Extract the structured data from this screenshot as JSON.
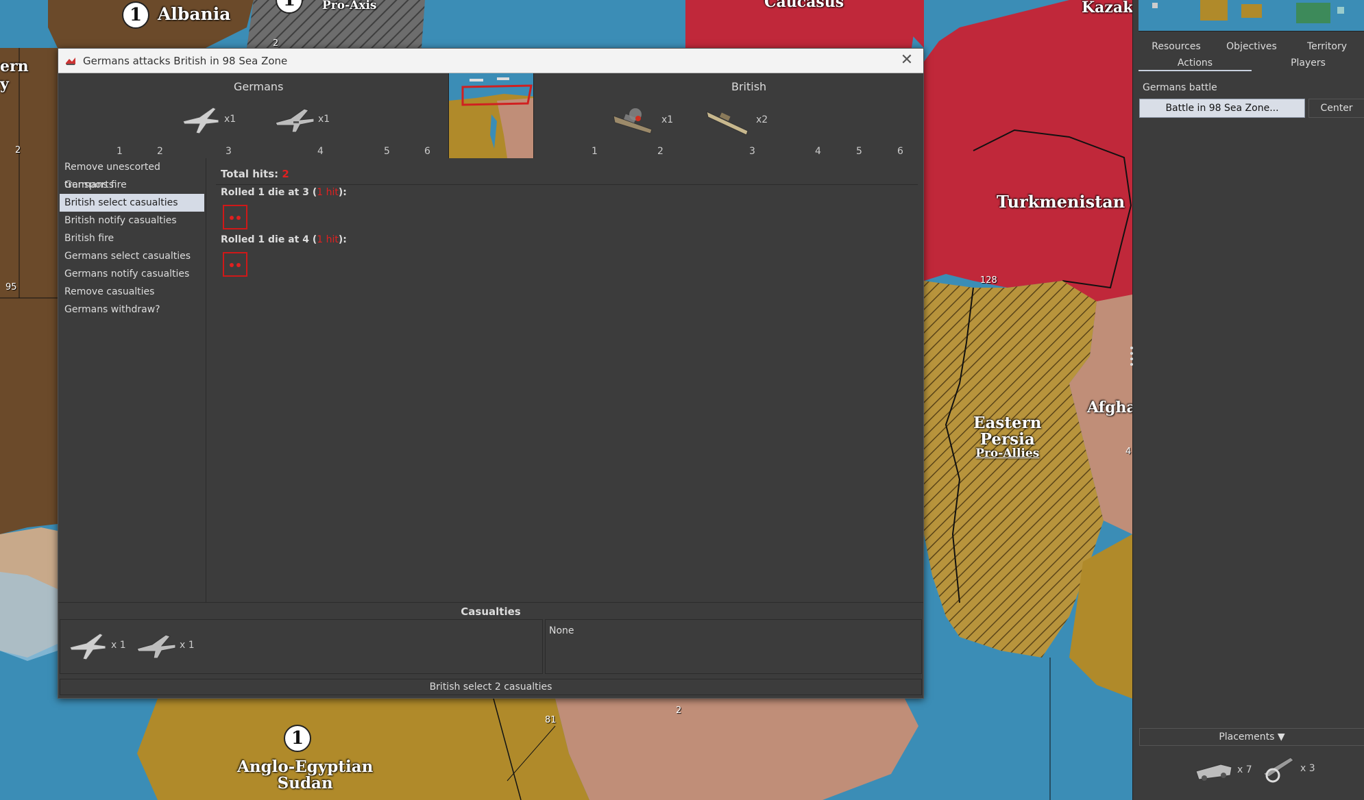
{
  "map": {
    "territories": {
      "albania": "Albania",
      "pro_axis": "Pro-Axis",
      "caucasus": "Caucasus",
      "kazakh": "Kazak",
      "turkmenistan": "Turkmenistan",
      "eastern_persia_1": "Eastern",
      "eastern_persia_2": "Persia",
      "eastern_persia_sub": "Pro-Allies",
      "afghan": "Afgha",
      "ern": "ern",
      "anglo_1": "Anglo-Egyptian",
      "anglo_2": "Sudan"
    },
    "circle_albania": "1",
    "circle_proaxis": "1",
    "circle_sudan": "1",
    "zone_95": "95",
    "zone_128": "128",
    "zone_81": "81",
    "stack_2a": "2",
    "stack_2b": "2",
    "stack_2c": "2",
    "num_4": "4",
    "y_label": "y"
  },
  "dialog": {
    "title": "Germans attacks British in 98 Sea Zone",
    "attacker": {
      "name": "Germans",
      "units": [
        {
          "icon": "fighter-plane-icon",
          "count": "x1"
        },
        {
          "icon": "tactical-bomber-icon",
          "count": "x1"
        }
      ],
      "die_labels": [
        "1",
        "2",
        "3",
        "4",
        "5",
        "6"
      ]
    },
    "defender": {
      "name": "British",
      "units": [
        {
          "icon": "damaged-battleship-icon",
          "count": "x1"
        },
        {
          "icon": "battleship-icon",
          "count": "x2"
        }
      ],
      "die_labels": [
        "1",
        "2",
        "3",
        "4",
        "5",
        "6"
      ]
    },
    "steps": [
      "Remove unescorted transports",
      "Germans fire",
      "British select casualties",
      "British notify casualties",
      "British fire",
      "Germans select casualties",
      "Germans notify casualties",
      "Remove casualties",
      "Germans withdraw?"
    ],
    "selected_step": 2,
    "results": {
      "total_hits_label": "Total hits:",
      "total_hits": "2",
      "roll1_prefix": "Rolled 1 die at 3 (",
      "roll1_hit": "1 hit",
      "roll1_suffix": "):",
      "roll2_prefix": "Rolled 1 die at 4 (",
      "roll2_hit": "1 hit",
      "roll2_suffix": "):"
    },
    "casualties": {
      "heading": "Casualties",
      "left": [
        {
          "icon": "fighter-plane-icon",
          "count": "x 1"
        },
        {
          "icon": "tactical-bomber-icon",
          "count": "x 1"
        }
      ],
      "right": "None"
    },
    "status": "British select 2 casualties"
  },
  "panel": {
    "tabs_row1": [
      "Resources",
      "Objectives",
      "Territory"
    ],
    "tabs_row2": [
      "Actions",
      "Players"
    ],
    "section_label": "Germans battle",
    "battle_button": "Battle in 98 Sea Zone...",
    "center_button": "Center",
    "placements": "Placements ▼",
    "placement_units": [
      {
        "icon": "halftrack-icon",
        "count": "x 7"
      },
      {
        "icon": "artillery-icon",
        "count": "x 3"
      }
    ]
  },
  "colors": {
    "dialog_bg": "#3c3c3c",
    "hit_red": "#e02020",
    "selected_step": "#d5dbe6",
    "sea": "#3b8db6",
    "soviet_red": "#c0283a"
  }
}
